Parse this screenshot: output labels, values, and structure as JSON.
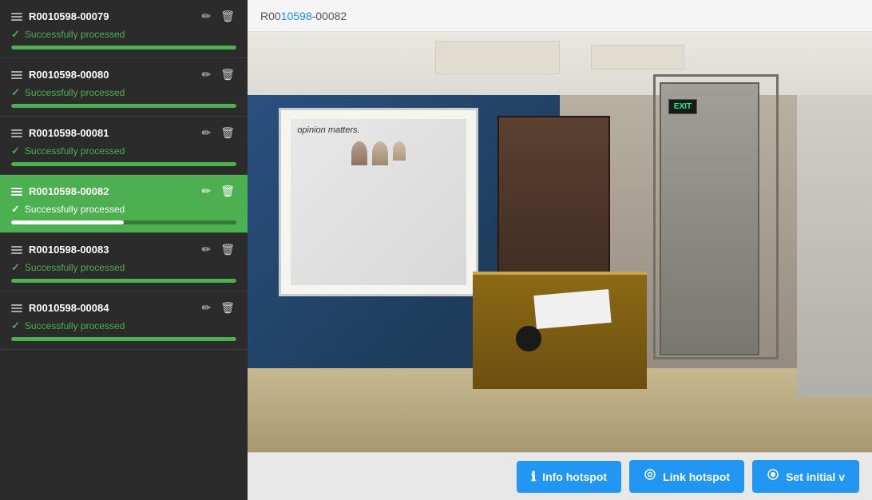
{
  "sidebar": {
    "items": [
      {
        "id": "R0010598-00079",
        "title": "R0010598-00079",
        "status": "Successfully processed",
        "progress": 100,
        "active": false
      },
      {
        "id": "R0010598-00080",
        "title": "R0010598-00080",
        "status": "Successfully processed",
        "progress": 100,
        "active": false
      },
      {
        "id": "R0010598-00081",
        "title": "R0010598-00081",
        "status": "Successfully processed",
        "progress": 100,
        "active": false
      },
      {
        "id": "R0010598-00082",
        "title": "R0010598-00082",
        "status": "Successfully processed",
        "progress": 50,
        "active": true
      },
      {
        "id": "R0010598-00083",
        "title": "R0010598-00083",
        "status": "Successfully processed",
        "progress": 100,
        "active": false
      },
      {
        "id": "R0010598-00084",
        "title": "R0010598-00084",
        "status": "Successfully processed",
        "progress": 100,
        "active": false
      }
    ]
  },
  "header": {
    "prefix": "R001",
    "suffix": "0598-00082",
    "full": "R0010598-00082",
    "blue_part": "0010598"
  },
  "toolbar": {
    "info_label": "Info hotspot",
    "link_label": "Link hotspot",
    "initial_label": "Set initial v",
    "info_icon": "ℹ",
    "link_icon": "◎",
    "initial_icon": "◉"
  },
  "scene": {
    "exit_text": "EXIT"
  }
}
